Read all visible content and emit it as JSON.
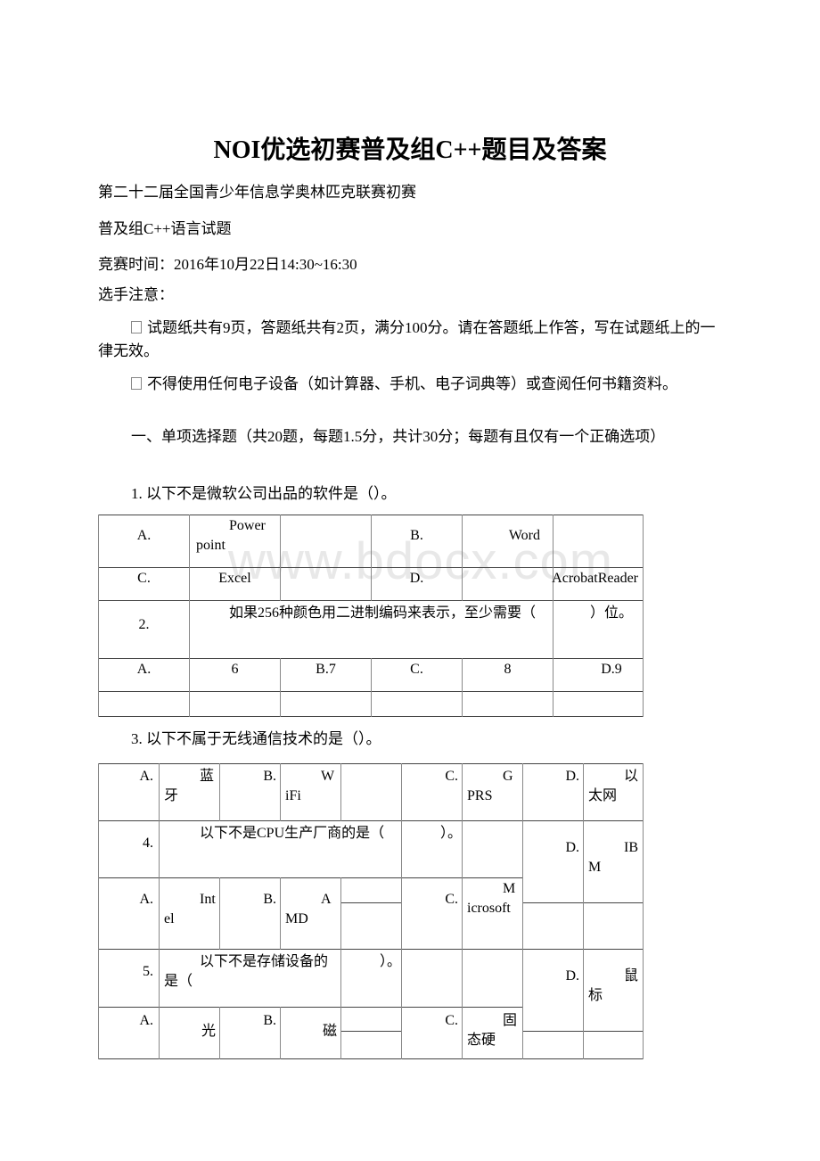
{
  "document": {
    "title": "NOI优选初赛普及组C++题目及答案",
    "lines": {
      "contest_name": "第二十二届全国青少年信息学奥林匹克联赛初赛",
      "group": "普及组C++语言试题",
      "time": "竞赛时间：2016年10月22日14:30~16:30",
      "notice_heading": "选手注意：",
      "notice_1": "试题纸共有9页，答题纸共有2页，满分100分。请在答题纸上作答，写在试题纸上的一律无效。",
      "notice_2": "不得使用任何电子设备（如计算器、手机、电子词典等）或查阅任何书籍资料。",
      "section_1": "一、单项选择题（共20题，每题1.5分，共计30分；每题有且仅有一个正确选项）",
      "q1": "1. 以下不是微软公司出品的软件是（）。",
      "q3": "3. 以下不属于无线通信技术的是（）。"
    },
    "watermark": "www.bdocx.com",
    "table1": {
      "q1_a_label": "A.",
      "q1_a_value": "Power point",
      "q1_b_label": "B.",
      "q1_b_value": "Word",
      "q1_c_label": "C.",
      "q1_c_value": "Excel",
      "q1_d_label": "D.",
      "q1_d_value": "AcrobatReader",
      "q2_number": "2.",
      "q2_text": "如果256种颜色用二进制编码来表示，至少需要（",
      "q2_tail": "）位。",
      "q2_a_label": "A.",
      "q2_a_value": "6",
      "q2_b": "B.7",
      "q2_c_label": "C.",
      "q2_c_value": "8",
      "q2_d": "D.9"
    },
    "table2": {
      "q3_a_label": "A.",
      "q3_a_value": "蓝牙",
      "q3_b_label": "B.",
      "q3_b_value": "WiFi",
      "q3_c_label": "C.",
      "q3_c_value": "GPRS",
      "q3_d_label": "D.",
      "q3_d_value": "以太网",
      "q4_number": "4.",
      "q4_text": "以下不是CPU生产厂商的是（",
      "q4_tail": "）。",
      "q4_a_label": "A.",
      "q4_a_value": "Intel",
      "q4_b_label": "B.",
      "q4_b_value": "AMD",
      "q4_c_label": "C.",
      "q4_c_value": "Microsoft",
      "q4_d_label": "D.",
      "q4_d_value": "IBM",
      "q5_number": "5.",
      "q5_text": "以下不是存储设备的是（",
      "q5_tail": "）。",
      "q5_a_label": "A.",
      "q5_a_value": "光",
      "q5_b_label": "B.",
      "q5_b_value": "磁",
      "q5_c_label": "C.",
      "q5_c_value": "固态硬",
      "q5_d_label": "D.",
      "q5_d_value": "鼠标"
    }
  }
}
